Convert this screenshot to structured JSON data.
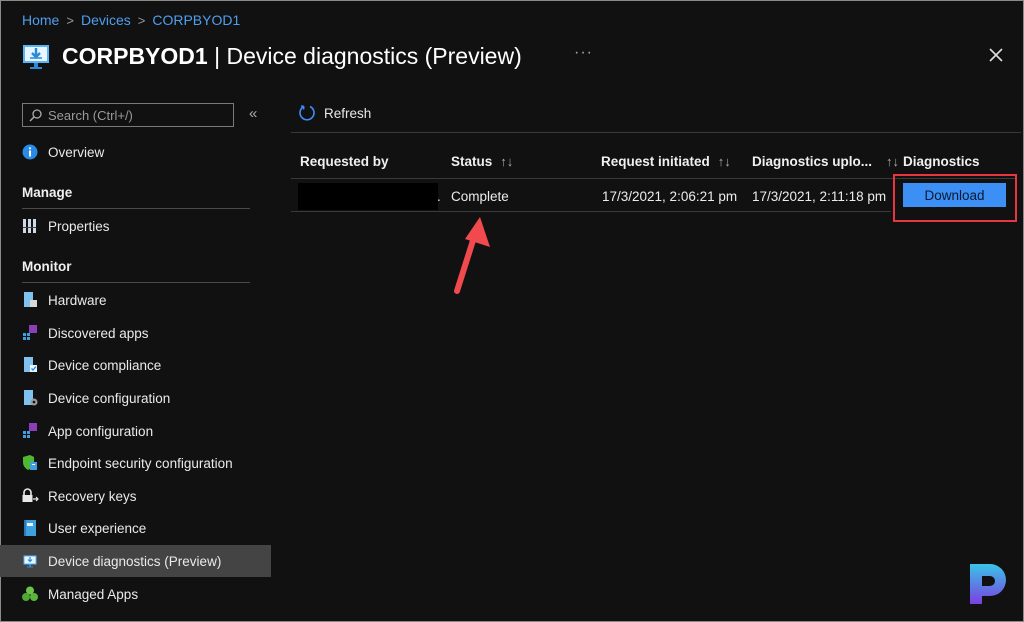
{
  "breadcrumb": [
    {
      "label": "Home"
    },
    {
      "label": "Devices"
    },
    {
      "label": "CORPBYOD1"
    }
  ],
  "header": {
    "device_name": "CORPBYOD1",
    "separator": " | ",
    "page_title": "Device diagnostics (Preview)",
    "more_label": "···",
    "icon": "device-diagnostics-icon",
    "close_icon": "close-icon"
  },
  "sidebar": {
    "search_placeholder": "Search (Ctrl+/)",
    "collapse_label": "«",
    "overview": {
      "label": "Overview",
      "icon": "info-icon"
    },
    "sections": [
      {
        "title": "Manage",
        "items": [
          {
            "label": "Properties",
            "icon": "properties-icon"
          }
        ]
      },
      {
        "title": "Monitor",
        "items": [
          {
            "label": "Hardware",
            "icon": "hardware-icon"
          },
          {
            "label": "Discovered apps",
            "icon": "discovered-apps-icon"
          },
          {
            "label": "Device compliance",
            "icon": "device-compliance-icon"
          },
          {
            "label": "Device configuration",
            "icon": "device-configuration-icon"
          },
          {
            "label": "App configuration",
            "icon": "app-configuration-icon"
          },
          {
            "label": "Endpoint security configuration",
            "icon": "endpoint-security-icon"
          },
          {
            "label": "Recovery keys",
            "icon": "recovery-keys-icon"
          },
          {
            "label": "User experience",
            "icon": "user-experience-icon"
          },
          {
            "label": "Device diagnostics (Preview)",
            "icon": "device-diagnostics-icon",
            "active": true
          },
          {
            "label": "Managed Apps",
            "icon": "managed-apps-icon"
          }
        ]
      }
    ]
  },
  "toolbar": {
    "refresh_label": "Refresh"
  },
  "table": {
    "columns": [
      {
        "label": "Requested by",
        "sortable": false
      },
      {
        "label": "Status",
        "sortable": true
      },
      {
        "label": "Request initiated",
        "sortable": true
      },
      {
        "label": "Diagnostics uplo...",
        "sortable": true
      },
      {
        "label": "Diagnostics",
        "sortable": false
      }
    ],
    "sort_glyph": "↑↓",
    "rows": [
      {
        "requested_by": "[redacted]",
        "trailing_dot": ".",
        "status": "Complete",
        "request_initiated": "17/3/2021, 2:06:21 pm",
        "diagnostics_uploaded": "17/3/2021, 2:11:18 pm",
        "action_label": "Download"
      }
    ]
  },
  "colors": {
    "accent": "#3b8ff5",
    "link": "#4f9ef0",
    "highlight": "#e8353f",
    "background": "#111111",
    "active_nav": "#444444"
  }
}
